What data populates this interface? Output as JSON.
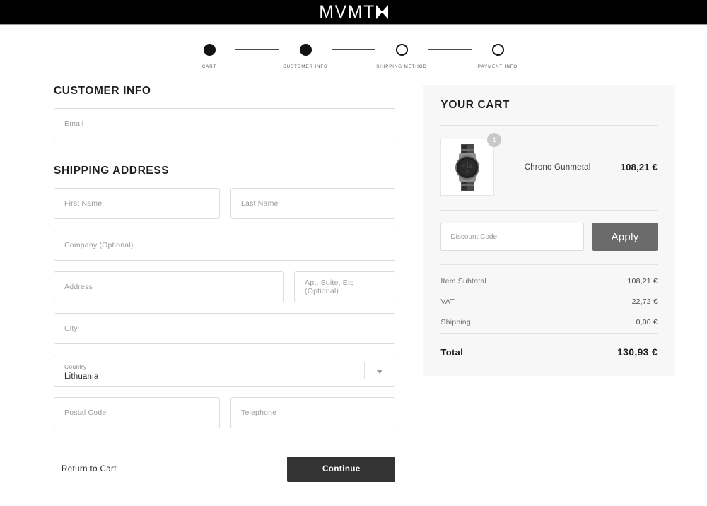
{
  "header": {
    "logo_text": "MVMT",
    "logo_mark": "hourglass-mark"
  },
  "stepper": {
    "steps": [
      {
        "label": "CART",
        "state": "filled"
      },
      {
        "label": "CUSTOMER INFO",
        "state": "filled"
      },
      {
        "label": "SHIPPING METHOD",
        "state": "empty"
      },
      {
        "label": "PAYMENT INFO",
        "state": "empty"
      }
    ]
  },
  "customer_info": {
    "title": "CUSTOMER INFO",
    "email_placeholder": "Email",
    "email_value": ""
  },
  "shipping_address": {
    "title": "SHIPPING ADDRESS",
    "first_name_placeholder": "First Name",
    "last_name_placeholder": "Last Name",
    "company_placeholder": "Company (Optional)",
    "address_placeholder": "Address",
    "apt_placeholder": "Apt, Suite, Etc (Optional)",
    "city_placeholder": "City",
    "country_label": "Country",
    "country_value": "Lithuania",
    "postal_placeholder": "Postal Code",
    "telephone_placeholder": "Telephone"
  },
  "actions": {
    "return_label": "Return to Cart",
    "continue_label": "Continue"
  },
  "cart": {
    "title": "YOUR CART",
    "item": {
      "name": "Chrono Gunmetal",
      "price": "108,21 €",
      "quantity": "1",
      "image": "watch-thumbnail"
    },
    "discount": {
      "placeholder": "Discount Code",
      "value": "",
      "apply_label": "Apply"
    },
    "summary": [
      {
        "label": "Item Subtotal",
        "value": "108,21 €"
      },
      {
        "label": "VAT",
        "value": "22,72 €"
      },
      {
        "label": "Shipping",
        "value": "0,00 €"
      }
    ],
    "total": {
      "label": "Total",
      "value": "130,93 €"
    }
  },
  "colors": {
    "header_bg": "#000000",
    "accent_dark": "#333333",
    "apply_btn": "#6b6b6b",
    "panel_bg": "#f7f7f7",
    "border": "#dcdcdc"
  }
}
